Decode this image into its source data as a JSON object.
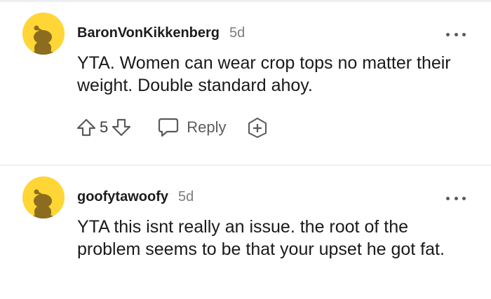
{
  "comments": [
    {
      "username": "BaronVonKikkenberg",
      "age": "5d",
      "text": "YTA. Women can wear crop tops no matter their weight. Double standard ahoy.",
      "score": "5",
      "reply_label": "Reply",
      "avatar_icon": "snoo-avatar-icon",
      "avatar_color": "#ffd635"
    },
    {
      "username": "goofytawoofy",
      "age": "5d",
      "text": "YTA this isnt really an issue. the root of the problem seems to be that your upset he got fat.",
      "avatar_icon": "snoo-avatar-icon",
      "avatar_color": "#ffd635"
    }
  ],
  "icons": {
    "upvote": "upvote-arrow-icon",
    "downvote": "downvote-arrow-icon",
    "reply": "speech-bubble-icon",
    "award": "award-plus-icon",
    "more": "more-options-icon"
  },
  "colors": {
    "avatar_bg": "#ffd635",
    "avatar_snoo": "#8c6d1f",
    "meta_text": "#7c7c7c",
    "divider": "#edeff1"
  }
}
